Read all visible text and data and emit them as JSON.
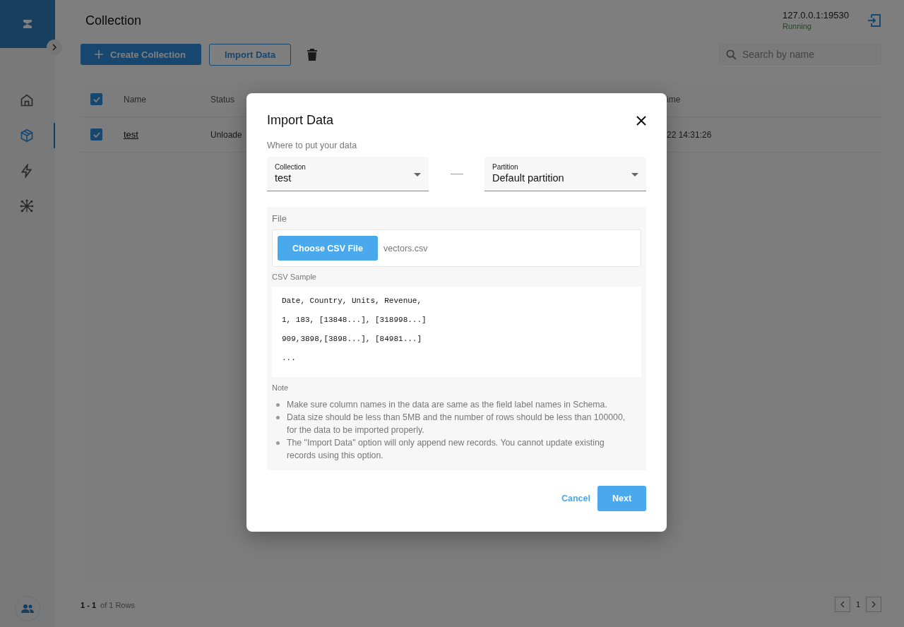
{
  "sidebar": {
    "items": [
      {
        "selected": false
      },
      {
        "selected": true
      },
      {
        "selected": false
      },
      {
        "selected": false
      }
    ]
  },
  "header": {
    "title": "Collection",
    "server": "127.0.0.1:19530",
    "status": "Running"
  },
  "toolbar": {
    "create_button": "Create Collection",
    "import_button": "Import Data",
    "search": {
      "placeholder": "Search by name"
    }
  },
  "table": {
    "header_checked": true,
    "columns": [
      "Name",
      "Status",
      "ime"
    ],
    "rows": [
      {
        "checked": true,
        "cells": [
          "test",
          "Unloade",
          "22 14:31:26"
        ]
      }
    ]
  },
  "pagination": {
    "range": "1 - 1",
    "total": "of 1 Rows",
    "page": "1"
  },
  "dialog": {
    "title": "Import Data",
    "subtitle": "Where to put your data",
    "collection_select": {
      "label": "Collection",
      "value": "test"
    },
    "partition_select": {
      "label": "Partition",
      "value": "Default partition"
    },
    "file": {
      "label": "File",
      "button": "Choose CSV File",
      "filename": "vectors.csv"
    },
    "csv_sample": {
      "label": "CSV Sample",
      "lines": [
        "Date, Country, Units, Revenue,",
        "1, 183, [13848...], [318998...]",
        "909,3898,[3898...], [84981...]",
        "..."
      ]
    },
    "note": {
      "label": "Note",
      "items": [
        "Make sure column names in the data are same as the field label names in Schema.",
        "Data size should be less than 5MB and the number of rows should be less than 100000, for the data to be imported properly.",
        "The \"Import Data\" option will only append new records. You cannot update existing records using this option."
      ]
    },
    "cancel_button": "Cancel",
    "next_button": "Next"
  }
}
